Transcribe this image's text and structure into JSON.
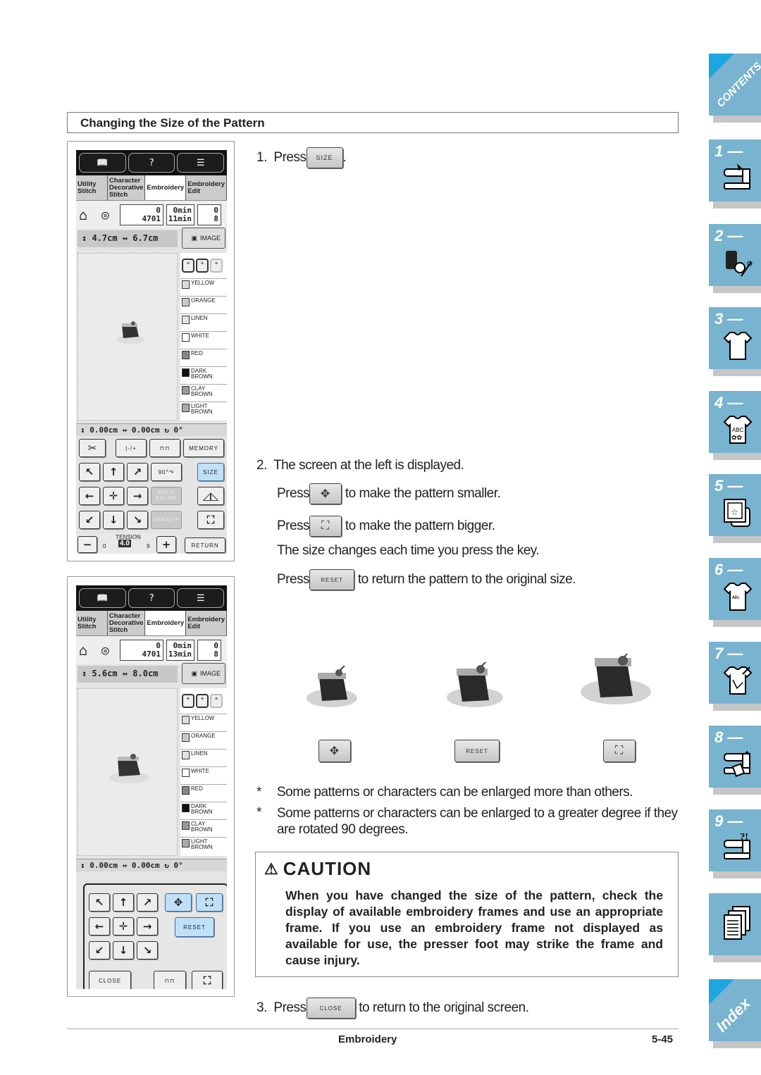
{
  "section_title": "Changing the Size of the Pattern",
  "screen1": {
    "tabs": [
      "Utility Stitch",
      "Character Decorative Stitch",
      "Embroidery",
      "Embroidery Edit"
    ],
    "active_tab": "Embroidery",
    "stitch_count_top": "0",
    "stitch_count_total": "4701",
    "time_top": "0min",
    "time_total": "11min",
    "color_top": "0",
    "color_total": "8",
    "height": "4.7cm",
    "width": "6.7cm",
    "image_label": "IMAGE",
    "colors": [
      "YELLOW",
      "ORANGE",
      "LINEN",
      "WHITE",
      "RED",
      "DARK BROWN",
      "CLAY BROWN",
      "LIGHT BROWN"
    ],
    "pos_y": "0.00cm",
    "pos_x": "0.00cm",
    "angle": "0°",
    "memory_label": "MEMORY",
    "rotate_label": "90°",
    "size_label": "SIZE",
    "multicolor_label": "MULTI COLOR",
    "density_label": "DENSITY",
    "tension_label": "TENSION",
    "tension_value": "4.0",
    "tension_min": "0",
    "tension_max": "9",
    "return_label": "RETURN"
  },
  "screen2": {
    "tabs": [
      "Utility Stitch",
      "Character Decorative Stitch",
      "Embroidery",
      "Embroidery Edit"
    ],
    "stitch_count_top": "0",
    "stitch_count_total": "4701",
    "time_top": "0min",
    "time_total": "13min",
    "color_top": "0",
    "color_total": "8",
    "height": "5.6cm",
    "width": "8.0cm",
    "image_label": "IMAGE",
    "colors": [
      "YELLOW",
      "ORANGE",
      "LINEN",
      "WHITE",
      "RED",
      "DARK BROWN",
      "CLAY BROWN",
      "LIGHT BROWN"
    ],
    "pos_y": "0.00cm",
    "pos_x": "0.00cm",
    "angle": "0°",
    "reset_label": "RESET",
    "close_label": "CLOSE"
  },
  "steps": {
    "s1_num": "1.",
    "s1_press": "Press",
    "s1_btn": "SIZE",
    "s1_end": ".",
    "s2_num": "2.",
    "s2_text": "The screen at the left is displayed.",
    "press": "Press",
    "smaller": "to make the pattern smaller.",
    "bigger": "to make the pattern bigger.",
    "each_time": "The size changes each time you press the key.",
    "reset_btn": "RESET",
    "reset_text": "to return the pattern to the original size.",
    "s3_num": "3.",
    "close_btn": "CLOSE",
    "s3_text": "to return to the original screen."
  },
  "demo": {
    "reset_label": "RESET"
  },
  "notes": [
    "Some patterns or characters can be enlarged more than others.",
    "Some patterns or characters can be enlarged to a greater degree if they are rotated 90 degrees."
  ],
  "caution": {
    "title": "CAUTION",
    "text": "When you have changed the size of the pattern, check the display of available embroidery frames and use an appropriate frame. If you use an embroidery frame not displayed as available for use, the presser foot may strike the frame and cause injury."
  },
  "footer": {
    "chapter": "Embroidery",
    "page": "5-45"
  },
  "side_tabs": {
    "contents": "CONTENTS",
    "chapters": [
      "1 —",
      "2 —",
      "3 —",
      "4 —",
      "5 —",
      "6 —",
      "7 —",
      "8 —",
      "9 —"
    ],
    "index": "Index"
  },
  "colors": {
    "tab_blue": "#78b3cf",
    "corner_blue": "#1ea6e0",
    "key_blue": "#bfe0f8"
  }
}
